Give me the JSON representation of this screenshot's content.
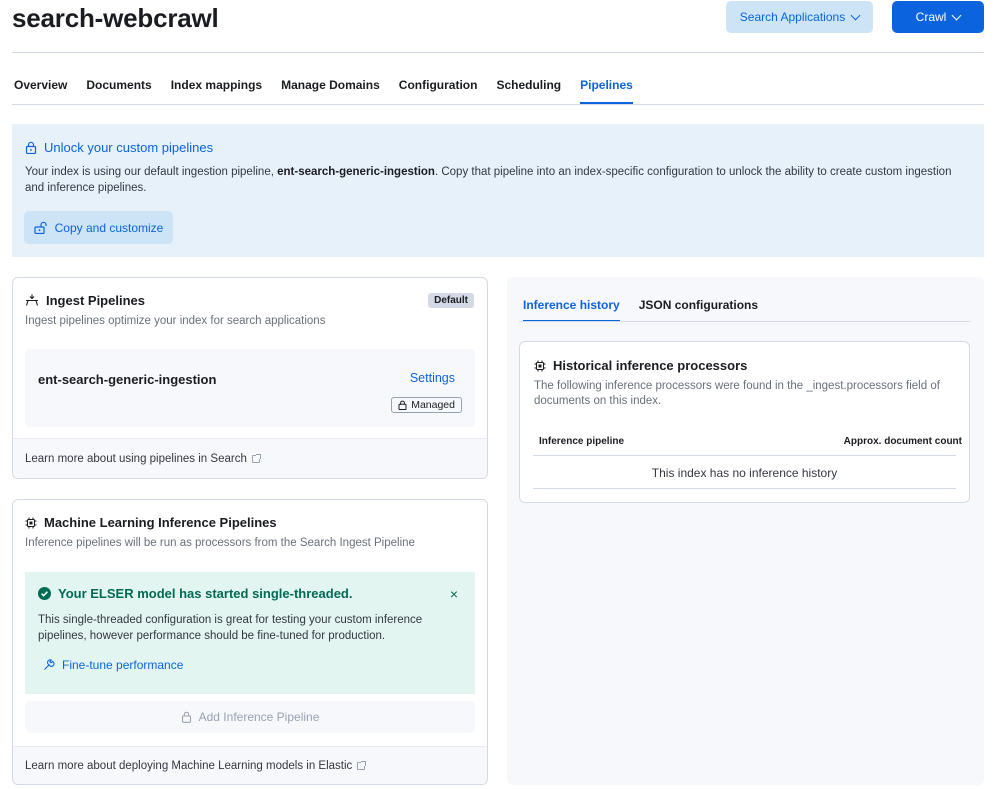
{
  "header": {
    "title": "search-webcrawl",
    "search_apps_label": "Search Applications",
    "crawl_label": "Crawl"
  },
  "tabs": [
    {
      "label": "Overview"
    },
    {
      "label": "Documents"
    },
    {
      "label": "Index mappings"
    },
    {
      "label": "Manage Domains"
    },
    {
      "label": "Configuration"
    },
    {
      "label": "Scheduling"
    },
    {
      "label": "Pipelines",
      "active": true
    }
  ],
  "unlock_callout": {
    "title": "Unlock your custom pipelines",
    "text_before": "Your index is using our default ingestion pipeline, ",
    "pipeline_name": "ent-search-generic-ingestion",
    "text_after": ". Copy that pipeline into an index-specific configuration to unlock the ability to create custom ingestion and inference pipelines.",
    "button_label": "Copy and customize"
  },
  "ingest_panel": {
    "title": "Ingest Pipelines",
    "badge": "Default",
    "subtitle": "Ingest pipelines optimize your index for search applications",
    "pipeline_name": "ent-search-generic-ingestion",
    "settings_label": "Settings",
    "managed_label": "Managed",
    "footer_link": "Learn more about using pipelines in Search"
  },
  "ml_panel": {
    "title": "Machine Learning Inference Pipelines",
    "subtitle": "Inference pipelines will be run as processors from the Search Ingest Pipeline",
    "toast_title": "Your ELSER model has started single-threaded.",
    "toast_close": "×",
    "toast_text": "This single-threaded configuration is great for testing your custom inference pipelines, however performance should be fine-tuned for production.",
    "toast_link": "Fine-tune performance",
    "add_button_label": "Add Inference Pipeline",
    "footer_link": "Learn more about deploying Machine Learning models in Elastic"
  },
  "right_panel": {
    "tabs": [
      {
        "label": "Inference history",
        "active": true
      },
      {
        "label": "JSON configurations"
      }
    ],
    "history_title": "Historical inference processors",
    "history_text": "The following inference processors were found in the _ingest.processors field of documents on this index.",
    "col_pipeline": "Inference pipeline",
    "col_count": "Approx. document count",
    "empty_message": "This index has no inference history"
  },
  "colors": {
    "primary": "#0b64dd",
    "success": "#006b55",
    "callout_bg": "#e6f1fa",
    "toast_bg": "#e2f5f1"
  },
  "icons": [
    "lock-icon",
    "unlock-icon",
    "ingest-pipeline-icon",
    "ml-chip-icon",
    "check-circle-icon",
    "wrench-icon",
    "external-link-icon",
    "chevron-down-icon",
    "close-icon"
  ]
}
